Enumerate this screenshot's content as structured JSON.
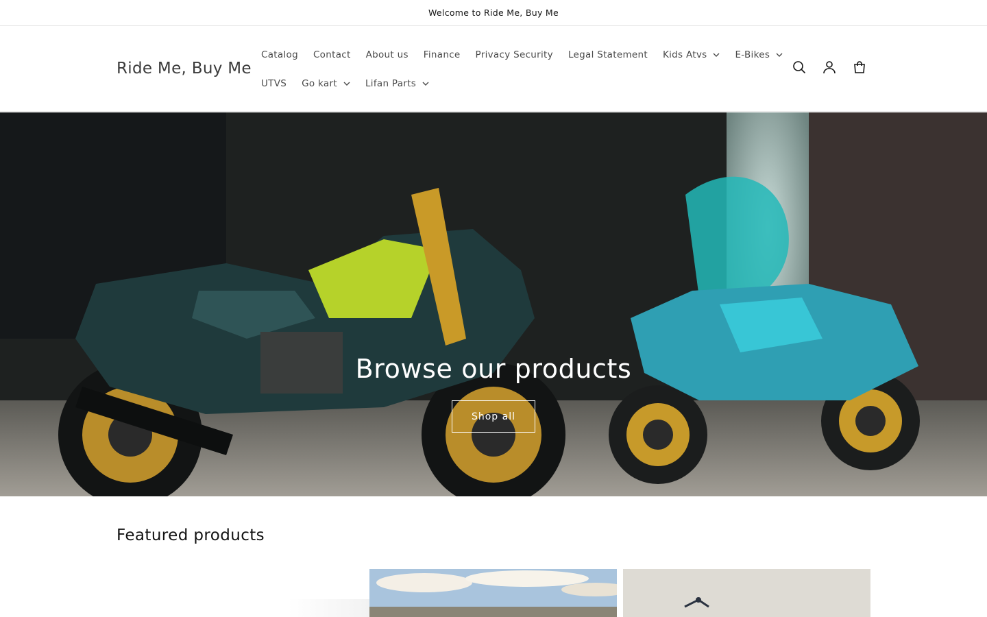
{
  "announcement": {
    "text": "Welcome to Ride Me, Buy Me"
  },
  "header": {
    "logo": "Ride Me, Buy Me",
    "nav_row1": [
      {
        "label": "Catalog",
        "dropdown": false
      },
      {
        "label": "Contact",
        "dropdown": false
      },
      {
        "label": "About us",
        "dropdown": false
      },
      {
        "label": "Finance",
        "dropdown": false
      },
      {
        "label": "Privacy Security",
        "dropdown": false
      },
      {
        "label": "Legal Statement",
        "dropdown": false
      },
      {
        "label": "Kids Atvs",
        "dropdown": true
      },
      {
        "label": "E-Bikes",
        "dropdown": true
      }
    ],
    "nav_row2": [
      {
        "label": "UTVS",
        "dropdown": false
      },
      {
        "label": "Go kart",
        "dropdown": true
      },
      {
        "label": "Lifan Parts",
        "dropdown": true
      }
    ],
    "icons": [
      "search-icon",
      "account-icon",
      "cart-icon"
    ]
  },
  "hero": {
    "title": "Browse our products",
    "button": "Shop all"
  },
  "featured": {
    "title": "Featured products"
  }
}
